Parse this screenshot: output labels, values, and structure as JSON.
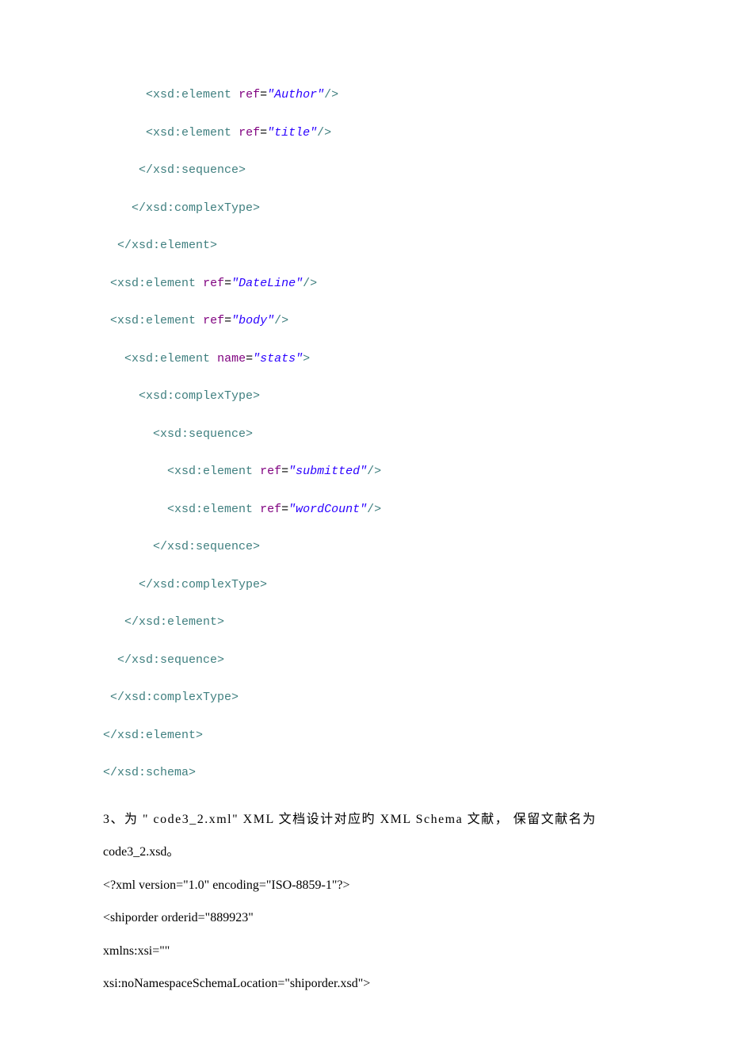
{
  "code": {
    "l1": "      <xsd:element ref=\"Author\"/>",
    "l2": "      <xsd:element ref=\"title\"/>",
    "l3": "     </xsd:sequence>",
    "l4": "    </xsd:complexType>",
    "l5": "  </xsd:element>",
    "l6": " <xsd:element ref=\"DateLine\"/>",
    "l7": " <xsd:element ref=\"body\"/>",
    "l8": "   <xsd:element name=\"stats\">",
    "l9": "     <xsd:complexType>",
    "l10": "       <xsd:sequence>",
    "l11": "         <xsd:element ref=\"submitted\"/>",
    "l12": "         <xsd:element ref=\"wordCount\"/>",
    "l13": "       </xsd:sequence>",
    "l14": "     </xsd:complexType>",
    "l15": "   </xsd:element>",
    "l16": "  </xsd:sequence>",
    "l17": " </xsd:complexType>",
    "l18": "</xsd:element>",
    "l19": "</xsd:schema>"
  },
  "text": {
    "q3a": "3、为  \" code3_2.xml\" XML  文档设计对应旳 XML Schema 文献， 保留文献名为",
    "q3b": "code3_2.xsd。",
    "x1": "<?xml version=\"1.0\" encoding=\"ISO-8859-1\"?>",
    "x2": "<shiporder orderid=\"889923\"",
    "x3": "xmlns:xsi=\"\"",
    "x4": "xsi:noNamespaceSchemaLocation=\"shiporder.xsd\">"
  },
  "tokens": {
    "ref": "ref",
    "name": "name",
    "Author": "\"Author\"",
    "title": "\"title\"",
    "DateLine": "\"DateLine\"",
    "body": "\"body\"",
    "stats": "\"stats\"",
    "submitted": "\"submitted\"",
    "wordCount": "\"wordCount\""
  }
}
